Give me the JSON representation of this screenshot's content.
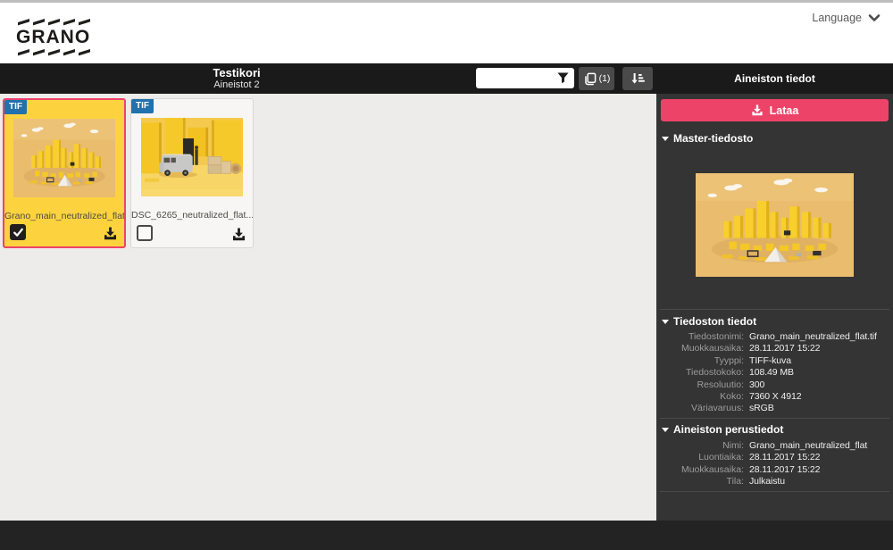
{
  "topbar": {
    "language_label": "Language"
  },
  "brand": {
    "logo_text": "GRANO"
  },
  "toolbar": {
    "title": "Testikori",
    "subtitle": "Aineistot 2",
    "search_value": "",
    "selection_count_label": "(1)",
    "panel_header": "Aineiston tiedot"
  },
  "cards": [
    {
      "badge": "TIF",
      "filename": "Grano_main_neutralized_flat",
      "selected": true
    },
    {
      "badge": "TIF",
      "filename": "DSC_6265_neutralized_flat...",
      "selected": false
    }
  ],
  "panel": {
    "download_button": "Lataa",
    "master_section_title": "Master-tiedosto",
    "file_section": {
      "title": "Tiedoston tiedot",
      "rows": [
        {
          "label": "Tiedostonimi:",
          "value": "Grano_main_neutralized_flat.tif"
        },
        {
          "label": "Muokkausaika:",
          "value": "28.11.2017 15:22"
        },
        {
          "label": "Tyyppi:",
          "value": "TIFF-kuva"
        },
        {
          "label": "Tiedostokoko:",
          "value": "108.49 MB"
        },
        {
          "label": "Resoluutio:",
          "value": "300"
        },
        {
          "label": "Koko:",
          "value": "7360 X 4912"
        },
        {
          "label": "Väriavaruus:",
          "value": "sRGB"
        }
      ]
    },
    "basic_section": {
      "title": "Aineiston perustiedot",
      "rows": [
        {
          "label": "Nimi:",
          "value": "Grano_main_neutralized_flat"
        },
        {
          "label": "Luontiaika:",
          "value": "28.11.2017 15:22"
        },
        {
          "label": "Muokkausaika:",
          "value": "28.11.2017 15:22"
        },
        {
          "label": "Tila:",
          "value": "Julkaistu"
        }
      ]
    }
  },
  "colors": {
    "accent_pink": "#ee4368",
    "badge_blue": "#2071ae",
    "selected_card_yellow": "#fcd33f",
    "toolbar_black": "#1a1a1a",
    "panel_gray": "#343434"
  }
}
